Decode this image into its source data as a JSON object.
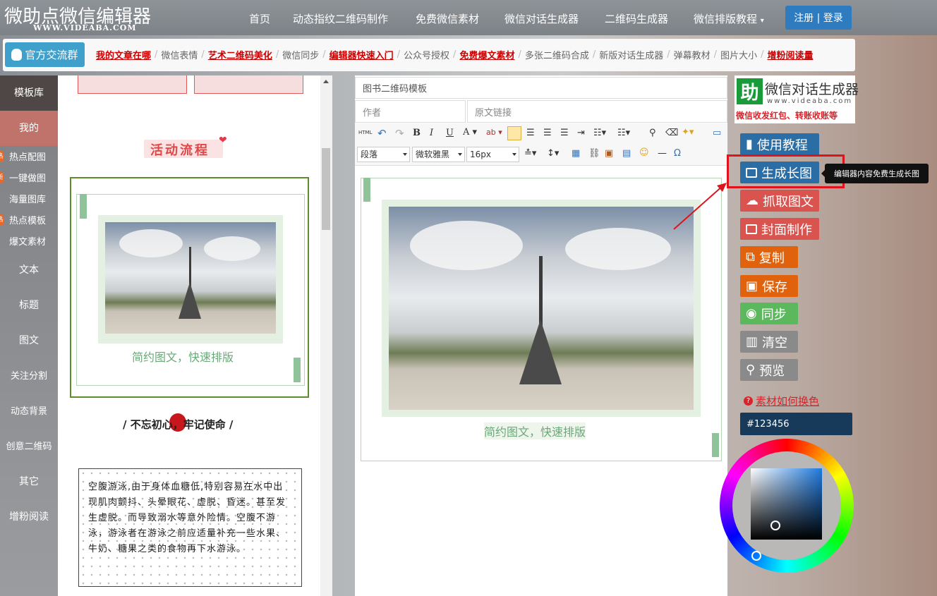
{
  "logo": {
    "title": "微助点微信编辑器",
    "subtitle": "WWW.VIDEABA.COM"
  },
  "nav": {
    "items": [
      "首页",
      "动态指纹二维码制作",
      "免费微信素材",
      "微信对话生成器",
      "二维码生成器",
      "微信排版教程"
    ],
    "auth": "注册 | 登录"
  },
  "linkbar": {
    "group_button": "官方交流群",
    "links": [
      {
        "text": "我的文章在哪",
        "hot": true
      },
      {
        "text": "微信表情",
        "hot": false
      },
      {
        "text": "艺术二维码美化",
        "hot": true
      },
      {
        "text": "微信同步",
        "hot": false
      },
      {
        "text": "编辑器快速入门",
        "hot": true
      },
      {
        "text": "公众号授权",
        "hot": false
      },
      {
        "text": "免费爆文素材",
        "hot": true
      },
      {
        "text": "多张二维码合成",
        "hot": false
      },
      {
        "text": "新版对话生成器",
        "hot": false
      },
      {
        "text": "弹幕教材",
        "hot": false
      },
      {
        "text": "图片大小",
        "hot": false
      },
      {
        "text": "增粉阅读量",
        "hot": true
      }
    ]
  },
  "sidebar": {
    "items": [
      "模板库",
      "我的",
      "热点配图",
      "一键做图",
      "海量图库",
      "热点模板",
      "爆文素材",
      "文本",
      "标题",
      "图文",
      "关注分割",
      "动态背景",
      "创意二维码",
      "其它",
      "增粉阅读"
    ]
  },
  "templates": {
    "activity_title": "活动流程",
    "caption": "简约图文，快速排版",
    "slogan": "/ 不忘初心，牢记使命 /",
    "paragraph": "空腹游泳,由于身体血糖低,特别容易在水中出现肌肉颤抖、头晕眼花、虚脱、昏迷。甚至发生虚脱。而导致溺水等意外险情。空腹不游泳，游泳者在游泳之前应适量补充一些水果、牛奶、糖果之类的食物再下水游泳。"
  },
  "editor": {
    "title_value": "图书二维码模板",
    "author_placeholder": "作者",
    "source_placeholder": "原文链接",
    "paragraph_select": "段落",
    "font_select": "微软雅黑",
    "size_select": "16px",
    "caption": "简约图文，快速排版"
  },
  "right_panel": {
    "ad_title": "微信对话生成器",
    "ad_url": "www.videaba.com",
    "ad_sub": "微信收发红包、转账收账等",
    "buttons": [
      {
        "label": "使用教程",
        "color": "#2b6ea5"
      },
      {
        "label": "生成长图",
        "color": "#2b6ea5"
      },
      {
        "label": "抓取图文",
        "color": "#d9534f"
      },
      {
        "label": "封面制作",
        "color": "#d9534f"
      },
      {
        "label": "复制",
        "color": "#e0620d"
      },
      {
        "label": "保存",
        "color": "#e0620d"
      },
      {
        "label": "同步",
        "color": "#5cb85c"
      },
      {
        "label": "清空",
        "color": "#8a8a8a"
      },
      {
        "label": "预览",
        "color": "#8a8a8a"
      }
    ],
    "tooltip": "编辑器内容免费生成长图",
    "color_help": "素材如何换色",
    "color_value": "#123456"
  }
}
